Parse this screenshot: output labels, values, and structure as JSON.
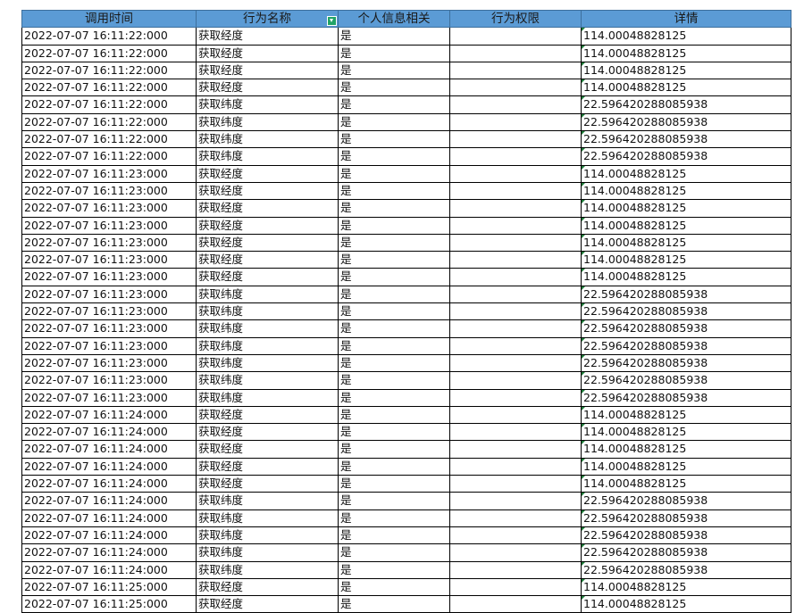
{
  "sheet": {
    "headers": [
      "调用时间",
      "行为名称",
      "个人信息相关",
      "行为权限",
      "详情"
    ],
    "rows": [
      [
        "2022-07-07 16:11:22:000",
        "获取经度",
        "是",
        "",
        "114.00048828125"
      ],
      [
        "2022-07-07 16:11:22:000",
        "获取经度",
        "是",
        "",
        "114.00048828125"
      ],
      [
        "2022-07-07 16:11:22:000",
        "获取经度",
        "是",
        "",
        "114.00048828125"
      ],
      [
        "2022-07-07 16:11:22:000",
        "获取经度",
        "是",
        "",
        "114.00048828125"
      ],
      [
        "2022-07-07 16:11:22:000",
        "获取纬度",
        "是",
        "",
        "22.596420288085938"
      ],
      [
        "2022-07-07 16:11:22:000",
        "获取纬度",
        "是",
        "",
        "22.596420288085938"
      ],
      [
        "2022-07-07 16:11:22:000",
        "获取纬度",
        "是",
        "",
        "22.596420288085938"
      ],
      [
        "2022-07-07 16:11:22:000",
        "获取纬度",
        "是",
        "",
        "22.596420288085938"
      ],
      [
        "2022-07-07 16:11:23:000",
        "获取经度",
        "是",
        "",
        "114.00048828125"
      ],
      [
        "2022-07-07 16:11:23:000",
        "获取经度",
        "是",
        "",
        "114.00048828125"
      ],
      [
        "2022-07-07 16:11:23:000",
        "获取经度",
        "是",
        "",
        "114.00048828125"
      ],
      [
        "2022-07-07 16:11:23:000",
        "获取经度",
        "是",
        "",
        "114.00048828125"
      ],
      [
        "2022-07-07 16:11:23:000",
        "获取经度",
        "是",
        "",
        "114.00048828125"
      ],
      [
        "2022-07-07 16:11:23:000",
        "获取经度",
        "是",
        "",
        "114.00048828125"
      ],
      [
        "2022-07-07 16:11:23:000",
        "获取经度",
        "是",
        "",
        "114.00048828125"
      ],
      [
        "2022-07-07 16:11:23:000",
        "获取纬度",
        "是",
        "",
        "22.596420288085938"
      ],
      [
        "2022-07-07 16:11:23:000",
        "获取纬度",
        "是",
        "",
        "22.596420288085938"
      ],
      [
        "2022-07-07 16:11:23:000",
        "获取纬度",
        "是",
        "",
        "22.596420288085938"
      ],
      [
        "2022-07-07 16:11:23:000",
        "获取纬度",
        "是",
        "",
        "22.596420288085938"
      ],
      [
        "2022-07-07 16:11:23:000",
        "获取纬度",
        "是",
        "",
        "22.596420288085938"
      ],
      [
        "2022-07-07 16:11:23:000",
        "获取纬度",
        "是",
        "",
        "22.596420288085938"
      ],
      [
        "2022-07-07 16:11:23:000",
        "获取纬度",
        "是",
        "",
        "22.596420288085938"
      ],
      [
        "2022-07-07 16:11:24:000",
        "获取经度",
        "是",
        "",
        "114.00048828125"
      ],
      [
        "2022-07-07 16:11:24:000",
        "获取经度",
        "是",
        "",
        "114.00048828125"
      ],
      [
        "2022-07-07 16:11:24:000",
        "获取经度",
        "是",
        "",
        "114.00048828125"
      ],
      [
        "2022-07-07 16:11:24:000",
        "获取经度",
        "是",
        "",
        "114.00048828125"
      ],
      [
        "2022-07-07 16:11:24:000",
        "获取经度",
        "是",
        "",
        "114.00048828125"
      ],
      [
        "2022-07-07 16:11:24:000",
        "获取纬度",
        "是",
        "",
        "22.596420288085938"
      ],
      [
        "2022-07-07 16:11:24:000",
        "获取纬度",
        "是",
        "",
        "22.596420288085938"
      ],
      [
        "2022-07-07 16:11:24:000",
        "获取纬度",
        "是",
        "",
        "22.596420288085938"
      ],
      [
        "2022-07-07 16:11:24:000",
        "获取纬度",
        "是",
        "",
        "22.596420288085938"
      ],
      [
        "2022-07-07 16:11:24:000",
        "获取纬度",
        "是",
        "",
        "22.596420288085938"
      ],
      [
        "2022-07-07 16:11:25:000",
        "获取经度",
        "是",
        "",
        "114.00048828125"
      ],
      [
        "2022-07-07 16:11:25:000",
        "获取经度",
        "是",
        "",
        "114.00048828125"
      ]
    ]
  },
  "colors": {
    "header_fill": "#5b9bd5",
    "filter_icon": "#21a366",
    "number_flag": "#1e7d3a"
  },
  "icons": {
    "filter": "filter-icon",
    "number_flag": "number-stored-as-text-icon"
  }
}
